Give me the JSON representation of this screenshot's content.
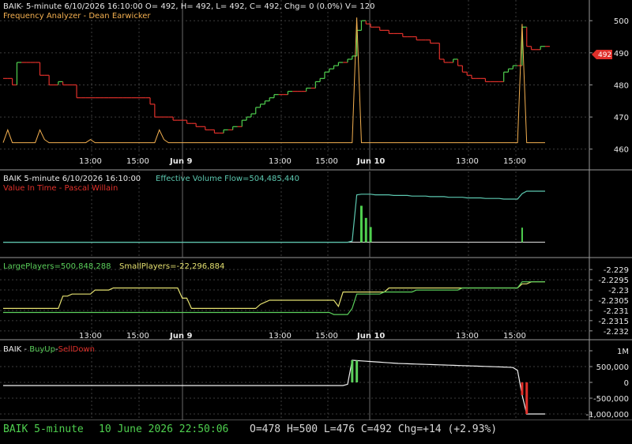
{
  "colors": {
    "background": "#000000",
    "grid": "#3c3c3c",
    "panel_border": "#9a9a9a",
    "price_red": "#e0302a",
    "price_green": "#4fd04f",
    "price_yellow": "#e8e070",
    "freq_orange": "#f4b050",
    "flow_green": "#4fd04f",
    "flow_teal": "#5cc8b0",
    "white": "#f0f0f0",
    "large_green": "#5bcf5b",
    "small_yellow": "#e4e070",
    "buyup_green": "#5bcf5b",
    "selldown_red": "#e0302a",
    "status_green": "#4fd04f",
    "status_white": "#d8d8d8"
  },
  "panel1": {
    "header": "BAIK- 5-minute 6/10/2026 16:10:00 O= 492, H= 492, L= 492, C= 492, Chg= 0 (0.0%) V= 120",
    "subheader": "Frequency Analyzer - Dean Earwicker",
    "price_marker": "492"
  },
  "panel2": {
    "header_left": "BAIK 5-minute  6/10/2026 16:10:00",
    "header_right": "Effective Volume Flow=504,485,440",
    "subheader": "Value In Time - Pascal Willain"
  },
  "panel3": {
    "large_label": "LargePlayers=500,848,288",
    "small_label": "SmallPlayers=-22,296,884"
  },
  "panel4": {
    "prefix": "BAIK - ",
    "buy_label": "BuyUp",
    "dash": "-",
    "sell_label": "SellDown"
  },
  "time_axis": {
    "labels": [
      "13:00",
      "15:00",
      "Jun 9",
      "13:00",
      "15:00",
      "Jun 10",
      "13:00",
      "15:00"
    ]
  },
  "status": {
    "symbol": "BAIK  5-minute",
    "datetime": "10 June 2026 22:50:06",
    "ohlc": "O=478  H=500  L=476  C=492  Chg=+14 (+2.93%)"
  },
  "chart_data": [
    {
      "type": "line",
      "title": "BAIK- 5-minute 6/10/2026 16:10:00 O= 492, H= 492, L= 492, C= 492, Chg= 0 (0.0%) V= 120",
      "y_ticks": [
        "500",
        "490",
        "480",
        "470",
        "460"
      ],
      "ylim": [
        456,
        503
      ],
      "x_ticks": [
        "13:00",
        "15:00",
        "Jun 9",
        "13:00",
        "15:00",
        "Jun 10",
        "13:00",
        "15:00"
      ],
      "series": [
        {
          "name": "BAIK",
          "y": [
            482,
            482,
            480,
            487,
            487,
            487,
            487,
            487,
            483,
            483,
            480,
            480,
            481,
            480,
            480,
            480,
            476,
            476,
            476,
            476,
            476,
            476,
            476,
            476,
            476,
            476,
            476,
            476,
            476,
            476,
            476,
            476,
            474,
            470,
            470,
            470,
            470,
            469,
            469,
            469,
            468,
            468,
            467,
            467,
            466,
            466,
            465,
            465,
            466,
            466,
            467,
            467,
            469,
            470,
            471,
            473,
            474,
            475,
            476,
            477,
            477,
            477,
            478,
            478,
            478,
            478,
            479,
            479,
            481,
            482,
            484,
            485,
            486,
            487,
            487,
            488,
            489,
            497,
            500,
            499,
            498,
            498,
            497,
            497,
            496,
            496,
            496,
            495,
            495,
            495,
            494,
            494,
            494,
            493,
            493,
            488,
            487,
            487,
            488,
            486,
            484,
            483,
            482,
            482,
            482,
            481,
            481,
            481,
            481,
            484,
            485,
            486,
            486,
            498,
            492,
            491,
            491,
            492,
            492
          ]
        },
        {
          "name": "Frequency Analyzer",
          "y": [
            462,
            466,
            462,
            462,
            462,
            462,
            462,
            462,
            466,
            463,
            462,
            462,
            462,
            462,
            462,
            462,
            462,
            462,
            462,
            463,
            462,
            462,
            462,
            462,
            462,
            462,
            462,
            462,
            462,
            462,
            462,
            462,
            462,
            462,
            466,
            463,
            462,
            462,
            462,
            462,
            462,
            462,
            462,
            462,
            462,
            462,
            462,
            462,
            462,
            462,
            462,
            462,
            462,
            462,
            462,
            462,
            462,
            462,
            462,
            462,
            462,
            462,
            462,
            462,
            462,
            462,
            462,
            462,
            462,
            462,
            462,
            462,
            462,
            462,
            462,
            462,
            462,
            501,
            462,
            462,
            462,
            462,
            462,
            462,
            462,
            462,
            462,
            462,
            462,
            462,
            462,
            462,
            462,
            462,
            462,
            462,
            462,
            462,
            462,
            462,
            462,
            462,
            462,
            462,
            462,
            462,
            462,
            462,
            462,
            462,
            462,
            462,
            462,
            499,
            462,
            462,
            462,
            462,
            462
          ]
        }
      ]
    },
    {
      "type": "line",
      "title": "Effective Volume Flow=504,485,440",
      "ylim": [
        -20,
        110
      ],
      "series": [
        {
          "name": "Effective Volume Flow",
          "y": [
            0,
            0,
            0,
            0,
            0,
            0,
            0,
            0,
            0,
            0,
            0,
            0,
            0,
            0,
            0,
            0,
            0,
            0,
            0,
            0,
            0,
            0,
            0,
            0,
            0,
            0,
            0,
            0,
            0,
            0,
            0,
            0,
            0,
            0,
            0,
            0,
            0,
            0,
            0,
            0,
            0,
            0,
            0,
            0,
            0,
            0,
            0,
            0,
            0,
            0,
            0,
            0,
            0,
            0,
            0,
            0,
            0,
            0,
            0,
            0,
            0,
            0,
            0,
            0,
            0,
            0,
            0,
            0,
            0,
            0,
            0,
            0,
            0,
            0,
            0,
            0,
            2,
            78,
            79,
            79,
            79,
            78,
            78,
            78,
            78,
            77,
            77,
            77,
            77,
            76,
            76,
            76,
            76,
            75,
            75,
            75,
            75,
            74,
            74,
            74,
            74,
            73,
            73,
            73,
            73,
            72,
            72,
            72,
            72,
            71,
            71,
            71,
            71,
            80,
            84,
            84,
            84,
            84,
            84
          ]
        },
        {
          "name": "Value In Time",
          "y": [
            0,
            0,
            0,
            0,
            0,
            0,
            0,
            0,
            0,
            0,
            0,
            0,
            0,
            0,
            0,
            0,
            0,
            0,
            0,
            0,
            0,
            0,
            0,
            0,
            0,
            0,
            0,
            0,
            0,
            0,
            0,
            0,
            0,
            0,
            0,
            0,
            0,
            0,
            0,
            0,
            0,
            0,
            0,
            0,
            0,
            0,
            0,
            0,
            0,
            0,
            0,
            0,
            0,
            0,
            0,
            0,
            0,
            0,
            0,
            0,
            0,
            0,
            0,
            0,
            0,
            0,
            0,
            0,
            0,
            0,
            0,
            0,
            0,
            0,
            0,
            0,
            0,
            0,
            0,
            0,
            0,
            0,
            0,
            0,
            0,
            0,
            0,
            0,
            0,
            0,
            0,
            0,
            0,
            0,
            0,
            0,
            0,
            0,
            0,
            0,
            0,
            0,
            0,
            0,
            0,
            0,
            0,
            0,
            0,
            0,
            0,
            0,
            0,
            0,
            0,
            0,
            0,
            0,
            0
          ]
        }
      ]
    },
    {
      "type": "line",
      "title": "LargePlayers / SmallPlayers",
      "y_ticks": [
        "-2.229",
        "-2.2295",
        "-2.23",
        "-2.2305",
        "-2.231",
        "-2.2315",
        "-2.232"
      ],
      "ylim": [
        -2.2322,
        -2.2288
      ],
      "series": [
        {
          "name": "LargePlayers",
          "y": [
            -2.2311,
            -2.2311,
            -2.2311,
            -2.2311,
            -2.2311,
            -2.2311,
            -2.2311,
            -2.2311,
            -2.2311,
            -2.2311,
            -2.2311,
            -2.2311,
            -2.2311,
            -2.2311,
            -2.2311,
            -2.2311,
            -2.2311,
            -2.2311,
            -2.2311,
            -2.2311,
            -2.2311,
            -2.2311,
            -2.2311,
            -2.2311,
            -2.2311,
            -2.2311,
            -2.2311,
            -2.2311,
            -2.2311,
            -2.2311,
            -2.2311,
            -2.2311,
            -2.2311,
            -2.2311,
            -2.2311,
            -2.2311,
            -2.2311,
            -2.2311,
            -2.2311,
            -2.2311,
            -2.2311,
            -2.2311,
            -2.2311,
            -2.2311,
            -2.2311,
            -2.2311,
            -2.2311,
            -2.2311,
            -2.2311,
            -2.2311,
            -2.2311,
            -2.2311,
            -2.2311,
            -2.2311,
            -2.2311,
            -2.2311,
            -2.2311,
            -2.2311,
            -2.2311,
            -2.2311,
            -2.2311,
            -2.2311,
            -2.2311,
            -2.2311,
            -2.2311,
            -2.2311,
            -2.2311,
            -2.2311,
            -2.2311,
            -2.2311,
            -2.2311,
            -2.2311,
            -2.2312,
            -2.2312,
            -2.2312,
            -2.2312,
            -2.2309,
            -2.2302,
            -2.2302,
            -2.2302,
            -2.2302,
            -2.2302,
            -2.2302,
            -2.2301,
            -2.2301,
            -2.2301,
            -2.2301,
            -2.2301,
            -2.2301,
            -2.2301,
            -2.23,
            -2.23,
            -2.23,
            -2.23,
            -2.23,
            -2.23,
            -2.23,
            -2.23,
            -2.23,
            -2.23,
            -2.2299,
            -2.2299,
            -2.2299,
            -2.2299,
            -2.2299,
            -2.2299,
            -2.2299,
            -2.2299,
            -2.2299,
            -2.2299,
            -2.2299,
            -2.2299,
            -2.2299,
            -2.2296,
            -2.2296,
            -2.2296,
            -2.2296,
            -2.2296,
            -2.2296
          ]
        },
        {
          "name": "SmallPlayers",
          "y": [
            -2.2309,
            -2.2309,
            -2.2309,
            -2.2309,
            -2.2309,
            -2.2309,
            -2.2309,
            -2.2309,
            -2.2309,
            -2.2309,
            -2.2309,
            -2.2309,
            -2.2309,
            -2.2303,
            -2.2303,
            -2.2302,
            -2.2302,
            -2.2302,
            -2.2302,
            -2.2302,
            -2.23,
            -2.23,
            -2.23,
            -2.23,
            -2.2299,
            -2.2299,
            -2.2299,
            -2.2299,
            -2.2299,
            -2.2299,
            -2.2299,
            -2.2299,
            -2.2299,
            -2.2299,
            -2.2299,
            -2.2299,
            -2.2299,
            -2.2299,
            -2.2299,
            -2.2304,
            -2.2304,
            -2.2309,
            -2.2309,
            -2.2309,
            -2.2309,
            -2.2309,
            -2.2309,
            -2.2309,
            -2.2309,
            -2.2309,
            -2.2309,
            -2.2309,
            -2.2309,
            -2.2309,
            -2.2309,
            -2.2309,
            -2.2307,
            -2.2306,
            -2.2305,
            -2.2305,
            -2.2305,
            -2.2305,
            -2.2305,
            -2.2305,
            -2.2305,
            -2.2305,
            -2.2305,
            -2.2305,
            -2.2305,
            -2.2305,
            -2.2305,
            -2.2305,
            -2.2305,
            -2.2308,
            -2.2301,
            -2.2301,
            -2.2301,
            -2.2301,
            -2.2301,
            -2.2301,
            -2.2301,
            -2.2301,
            -2.2301,
            -2.2301,
            -2.2299,
            -2.2299,
            -2.2299,
            -2.2299,
            -2.2299,
            -2.2299,
            -2.2299,
            -2.2299,
            -2.2299,
            -2.2299,
            -2.2299,
            -2.2299,
            -2.2299,
            -2.2299,
            -2.2299,
            -2.2299,
            -2.2299,
            -2.2299,
            -2.2299,
            -2.2299,
            -2.2299,
            -2.2299,
            -2.2299,
            -2.2299,
            -2.2299,
            -2.2299,
            -2.2299,
            -2.2299,
            -2.2299,
            -2.2297,
            -2.2297,
            -2.2296,
            -2.2296,
            -2.2296,
            -2.2296
          ]
        }
      ]
    },
    {
      "type": "line",
      "title": "BAIK - BuyUp-SellDown",
      "y_ticks": [
        "1M",
        "500,000",
        "0",
        "-500,000",
        "-1,000,000"
      ],
      "ylim": [
        -1100000,
        1100000
      ],
      "series": [
        {
          "name": "BuyUp-SellDown",
          "y": [
            -100000,
            -100000,
            -100000,
            -100000,
            -100000,
            -100000,
            -100000,
            -100000,
            -100000,
            -100000,
            -100000,
            -100000,
            -100000,
            -100000,
            -100000,
            -100000,
            -100000,
            -100000,
            -100000,
            -100000,
            -100000,
            -100000,
            -100000,
            -100000,
            -100000,
            -100000,
            -100000,
            -100000,
            -100000,
            -100000,
            -100000,
            -100000,
            -100000,
            -100000,
            -100000,
            -100000,
            -100000,
            -100000,
            -100000,
            -100000,
            -100000,
            -100000,
            -100000,
            -100000,
            -100000,
            -100000,
            -100000,
            -100000,
            -100000,
            -100000,
            -100000,
            -100000,
            -100000,
            -100000,
            -100000,
            -100000,
            -100000,
            -100000,
            -100000,
            -100000,
            -100000,
            -100000,
            -100000,
            -100000,
            -100000,
            -100000,
            -100000,
            -100000,
            -100000,
            -100000,
            -100000,
            -100000,
            -100000,
            -100000,
            -100000,
            -60000,
            700000,
            690000,
            680000,
            670000,
            660000,
            650000,
            640000,
            630000,
            620000,
            610000,
            600000,
            595000,
            590000,
            585000,
            580000,
            575000,
            570000,
            565000,
            560000,
            555000,
            550000,
            545000,
            540000,
            535000,
            530000,
            525000,
            520000,
            515000,
            510000,
            505000,
            500000,
            495000,
            490000,
            485000,
            480000,
            470000,
            380000,
            -400000,
            -1000000,
            -1000000,
            -1000000,
            -1000000,
            -1000000
          ]
        }
      ]
    }
  ]
}
